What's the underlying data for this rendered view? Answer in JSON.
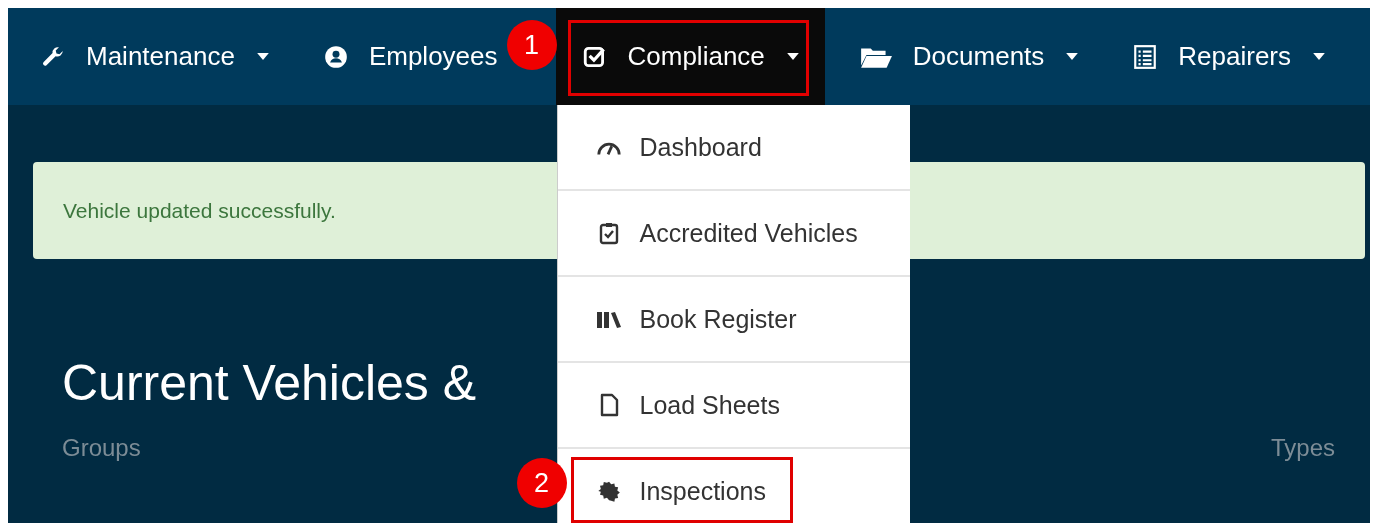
{
  "nav": [
    {
      "label": "Maintenance",
      "caret": true,
      "selected": false
    },
    {
      "label": "Employees",
      "caret": false,
      "selected": false
    },
    {
      "label": "Compliance",
      "caret": true,
      "selected": true,
      "callout": "1"
    },
    {
      "label": "Documents",
      "caret": true,
      "selected": false
    },
    {
      "label": "Repairers",
      "caret": true,
      "selected": false
    }
  ],
  "dropdown": [
    {
      "label": "Dashboard"
    },
    {
      "label": "Accredited Vehicles"
    },
    {
      "label": "Book Register"
    },
    {
      "label": "Load Sheets"
    },
    {
      "label": "Inspections",
      "callout": "2"
    }
  ],
  "alert": "Vehicle updated successfully.",
  "heading": "Current Vehicles &",
  "labels": [
    "Groups",
    "Types"
  ]
}
